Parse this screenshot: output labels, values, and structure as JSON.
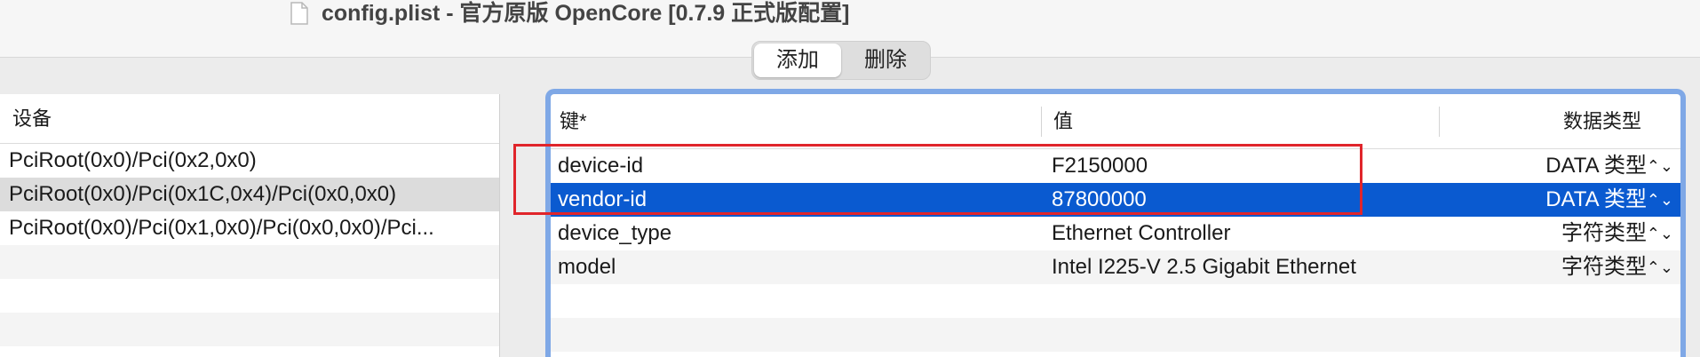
{
  "window": {
    "title": "config.plist - 官方原版 OpenCore [0.7.9 正式版配置]",
    "file_icon": "document-icon"
  },
  "toolbar": {
    "add_label": "添加",
    "delete_label": "删除"
  },
  "devices": {
    "header": "设备",
    "items": [
      "PciRoot(0x0)/Pci(0x2,0x0)",
      "PciRoot(0x0)/Pci(0x1C,0x4)/Pci(0x0,0x0)",
      "PciRoot(0x0)/Pci(0x1,0x0)/Pci(0x0,0x0)/Pci..."
    ],
    "selected_index": 1
  },
  "properties": {
    "headers": {
      "key": "键*",
      "value": "值",
      "type": "数据类型"
    },
    "rows": [
      {
        "key": "device-id",
        "value": "F2150000",
        "type": "DATA 类型"
      },
      {
        "key": "vendor-id",
        "value": "87800000",
        "type": "DATA 类型"
      },
      {
        "key": "device_type",
        "value": "Ethernet Controller",
        "type": "字符类型"
      },
      {
        "key": "model",
        "value": "Intel I225-V 2.5 Gigabit Ethernet",
        "type": "字符类型"
      }
    ],
    "selected_index": 1,
    "stepper_glyph": "⌃⌄"
  },
  "colors": {
    "selection": "#0a5ad0",
    "focus_ring": "#7fa8e6",
    "annotation_box": "#e0252b"
  }
}
